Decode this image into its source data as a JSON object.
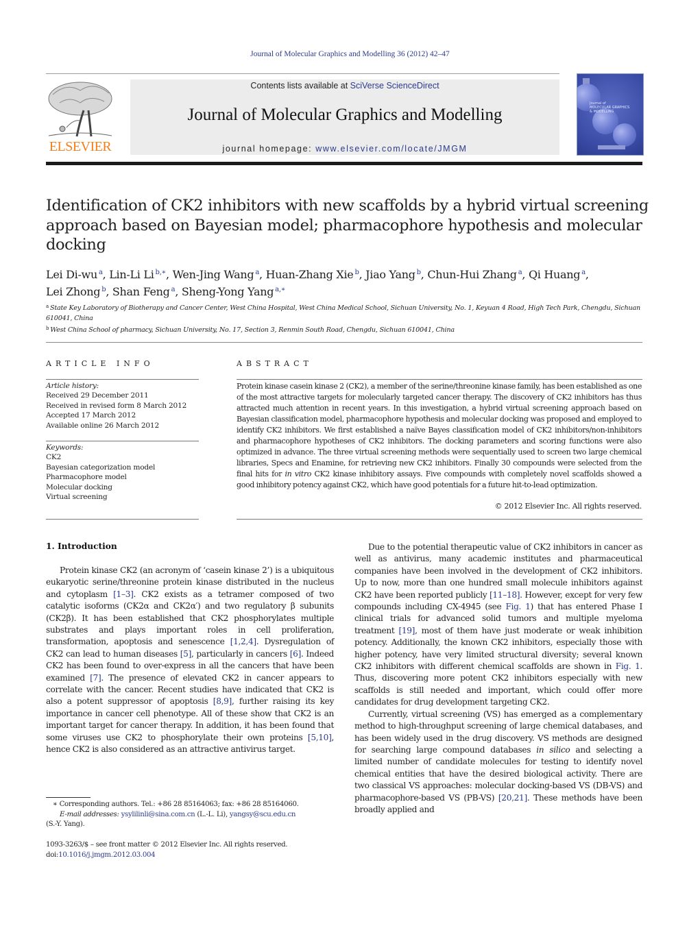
{
  "header": {
    "citation": "Journal of Molecular Graphics and Modelling 36 (2012) 42–47",
    "publisher_logo_text": "ELSEVIER",
    "contents_prefix": "Contents lists available at ",
    "contents_link": "SciVerse ScienceDirect",
    "journal_title": "Journal of Molecular Graphics and Modelling",
    "homepage_prefix": "journal homepage: ",
    "homepage_link": "www.elsevier.com/locate/JMGM",
    "cover_text_1": "Journal of",
    "cover_text_2": "MOLECULAR GRAPHICS",
    "cover_text_3": "& MODELLING"
  },
  "colors": {
    "link": "#2b3a8c",
    "elsevier_orange": "#f07f1c",
    "banner_bg": "#ececec",
    "cover_blue": "#3a4ba5"
  },
  "article": {
    "title": "Identification of CK2 inhibitors with new scaffolds by a hybrid virtual screening approach based on Bayesian model; pharmacophore hypothesis and molecular docking",
    "authors": [
      {
        "name": "Lei Di-wu",
        "aff": "a"
      },
      {
        "name": "Lin-Li Li",
        "aff": "b,∗"
      },
      {
        "name": "Wen-Jing Wang",
        "aff": "a"
      },
      {
        "name": "Huan-Zhang Xie",
        "aff": "b"
      },
      {
        "name": "Jiao Yang",
        "aff": "b"
      },
      {
        "name": "Chun-Hui Zhang",
        "aff": "a"
      },
      {
        "name": "Qi Huang",
        "aff": "a"
      },
      {
        "name": "Lei Zhong",
        "aff": "b"
      },
      {
        "name": "Shan Feng",
        "aff": "a"
      },
      {
        "name": "Sheng-Yong Yang",
        "aff": "a,∗"
      }
    ],
    "affiliations": [
      {
        "key": "a",
        "text": "State Key Laboratory of Biotherapy and Cancer Center, West China Hospital, West China Medical School, Sichuan University, No. 1, Keyuan 4 Road, High Tech Park, Chengdu, Sichuan 610041, China"
      },
      {
        "key": "b",
        "text": "West China School of pharmacy, Sichuan University, No. 17, Section 3, Renmin South Road, Chengdu, Sichuan 610041, China"
      }
    ]
  },
  "article_info": {
    "heading": "ARTICLE INFO",
    "history_label": "Article history:",
    "history": [
      "Received 29 December 2011",
      "Received in revised form 8 March 2012",
      "Accepted 17 March 2012",
      "Available online 26 March 2012"
    ],
    "keywords_label": "Keywords:",
    "keywords": [
      "CK2",
      "Bayesian categorization model",
      "Pharmacophore model",
      "Molecular docking",
      "Virtual screening"
    ]
  },
  "abstract": {
    "heading": "ABSTRACT",
    "text_1": "Protein kinase casein kinase 2 (CK2), a member of the serine/threonine kinase family, has been established as one of the most attractive targets for molecularly targeted cancer therapy. The discovery of CK2 inhibitors has thus attracted much attention in recent years. In this investigation, a hybrid virtual screening approach based on Bayesian classification model, pharmacophore hypothesis and molecular docking was proposed and employed to identify CK2 inhibitors. We first established a naïve Bayes classification model of CK2 inhibitors/non-inhibitors and pharmacophore hypotheses of CK2 inhibitors. The docking parameters and scoring functions were also optimized in advance. The three virtual screening methods were sequentially used to screen two large chemical libraries, Specs and Enamine, for retrieving new CK2 inhibitors. Finally 30 compounds were selected from the final hits for ",
    "text_italic": "in vitro",
    "text_2": " CK2 kinase inhibitory assays. Five compounds with completely novel scaffolds showed a good inhibitory potency against CK2, which have good potentials for a future hit-to-lead optimization.",
    "copyright": "© 2012 Elsevier Inc. All rights reserved."
  },
  "intro": {
    "heading": "1.  Introduction",
    "left_paragraph": [
      {
        "t": "Protein kinase CK2 (an acronym of ‘casein kinase 2’) is a ubiquitous eukaryotic serine/threonine protein kinase distributed in the nucleus and cytoplasm "
      },
      {
        "ref": "[1–3]"
      },
      {
        "t": ". CK2 exists as a tetramer composed of two catalytic isoforms (CK2α and CK2α′) and two regulatory β subunits (CK2β). It has been established that CK2 phosphorylates multiple substrates and plays important roles in cell proliferation, transformation, apoptosis and senescence "
      },
      {
        "ref": "[1,2,4]"
      },
      {
        "t": ". Dysregulation of CK2 can lead to human diseases "
      },
      {
        "ref": "[5]"
      },
      {
        "t": ", particularly in cancers "
      },
      {
        "ref": "[6]"
      },
      {
        "t": ". Indeed CK2 has been found to over-express in all the cancers that have been examined "
      },
      {
        "ref": "[7]"
      },
      {
        "t": ". The presence of elevated CK2 in cancer appears to correlate with the cancer. Recent studies have indicated that CK2 is also a potent suppressor of apoptosis "
      },
      {
        "ref": "[8,9]"
      },
      {
        "t": ", further raising its key importance in cancer cell phenotype. All of these show that CK2 is an important target for cancer therapy. In addition, it has been found that some viruses use CK2 to phosphorylate their own proteins "
      },
      {
        "ref": "[5,10]"
      },
      {
        "t": ", hence CK2 is also considered as an attractive antivirus target."
      }
    ],
    "right_paragraph_1": [
      {
        "t": "Due to the potential therapeutic value of CK2 inhibitors in cancer as well as antivirus, many academic institutes and pharmaceutical companies have been involved in the development of CK2 inhibitors. Up to now, more than one hundred small molecule inhibitors against CK2 have been reported publicly "
      },
      {
        "ref": "[11–18]"
      },
      {
        "t": ". However, except for very few compounds including CX-4945 (see "
      },
      {
        "ref": "Fig. 1"
      },
      {
        "t": ") that has entered Phase I clinical trials for advanced solid tumors and multiple myeloma treatment "
      },
      {
        "ref": "[19]"
      },
      {
        "t": ", most of them have just moderate or weak inhibition potency. Additionally, the known CK2 inhibitors, especially those with higher potency, have very limited structural diversity; several known CK2 inhibitors with different chemical scaffolds are shown in "
      },
      {
        "ref": "Fig. 1"
      },
      {
        "t": ". Thus, discovering more potent CK2 inhibitors especially with new scaffolds is still needed and important, which could offer more candidates for drug development targeting CK2."
      }
    ],
    "right_paragraph_2": [
      {
        "t": "Currently, virtual screening (VS) has emerged as a complementary method to high-throughput screening of large chemical databases, and has been widely used in the drug discovery. VS methods are designed for searching large compound databases "
      },
      {
        "i": "in silico"
      },
      {
        "t": " and selecting a limited number of candidate molecules for testing to identify novel chemical entities that have the desired biological activity. There are two classical VS approaches: molecular docking-based VS (DB-VS) and pharmacophore-based VS (PB-VS) "
      },
      {
        "ref": "[20,21]"
      },
      {
        "t": ". These methods have been broadly applied and"
      }
    ]
  },
  "footnotes": {
    "corresponding": "∗  Corresponding authors. Tel.: +86 28 85164063; fax: +86 28 85164060.",
    "email_label": "E-mail addresses: ",
    "email_1": "ysylilinli@sina.com.cn",
    "email_1_owner": " (L.-L. Li), ",
    "email_2": "yangsy@scu.edu.cn",
    "email_2_owner": "(S.-Y. Yang).",
    "frontmatter": "1093-3263/$ – see front matter © 2012 Elsevier Inc. All rights reserved.",
    "doi_prefix": "doi:",
    "doi_link": "10.1016/j.jmgm.2012.03.004"
  }
}
